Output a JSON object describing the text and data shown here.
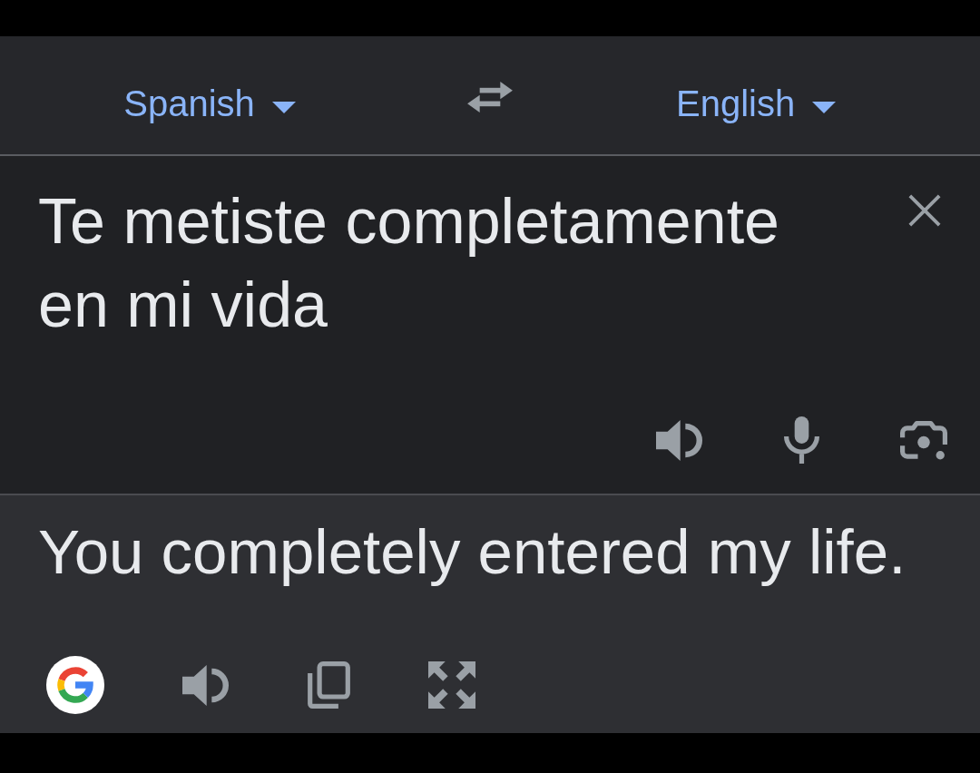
{
  "language_bar": {
    "source_language": "Spanish",
    "target_language": "English"
  },
  "source": {
    "value": "Te metiste completamente en mi vida"
  },
  "translation": {
    "text": "You completely entered my life."
  }
}
